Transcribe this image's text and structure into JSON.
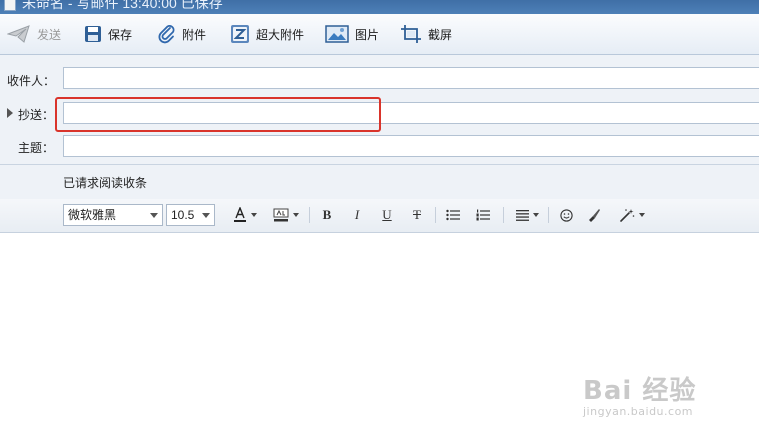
{
  "window": {
    "title": "未命名 - 写邮件 13:40:00 已保存"
  },
  "toolbar": {
    "send_label": "发送",
    "save_label": "保存",
    "attach_label": "附件",
    "large_attach_label": "超大附件",
    "image_label": "图片",
    "screenshot_label": "截屏"
  },
  "fields": {
    "to_label": "收件人：",
    "cc_label": "抄送：",
    "subject_label": "主题：",
    "to_value": "",
    "cc_value": "",
    "subject_value": ""
  },
  "receipt": {
    "text": "已请求阅读收条"
  },
  "format": {
    "font_name": "微软雅黑",
    "font_size": "10.5",
    "bold": "B",
    "italic": "I",
    "underline": "U",
    "strike": "T"
  },
  "watermark": {
    "brand": "Bai 经验",
    "url": "jingyan.baidu.com"
  },
  "colors": {
    "highlight": "#d9342b",
    "titlebar": "#4d80b8"
  }
}
